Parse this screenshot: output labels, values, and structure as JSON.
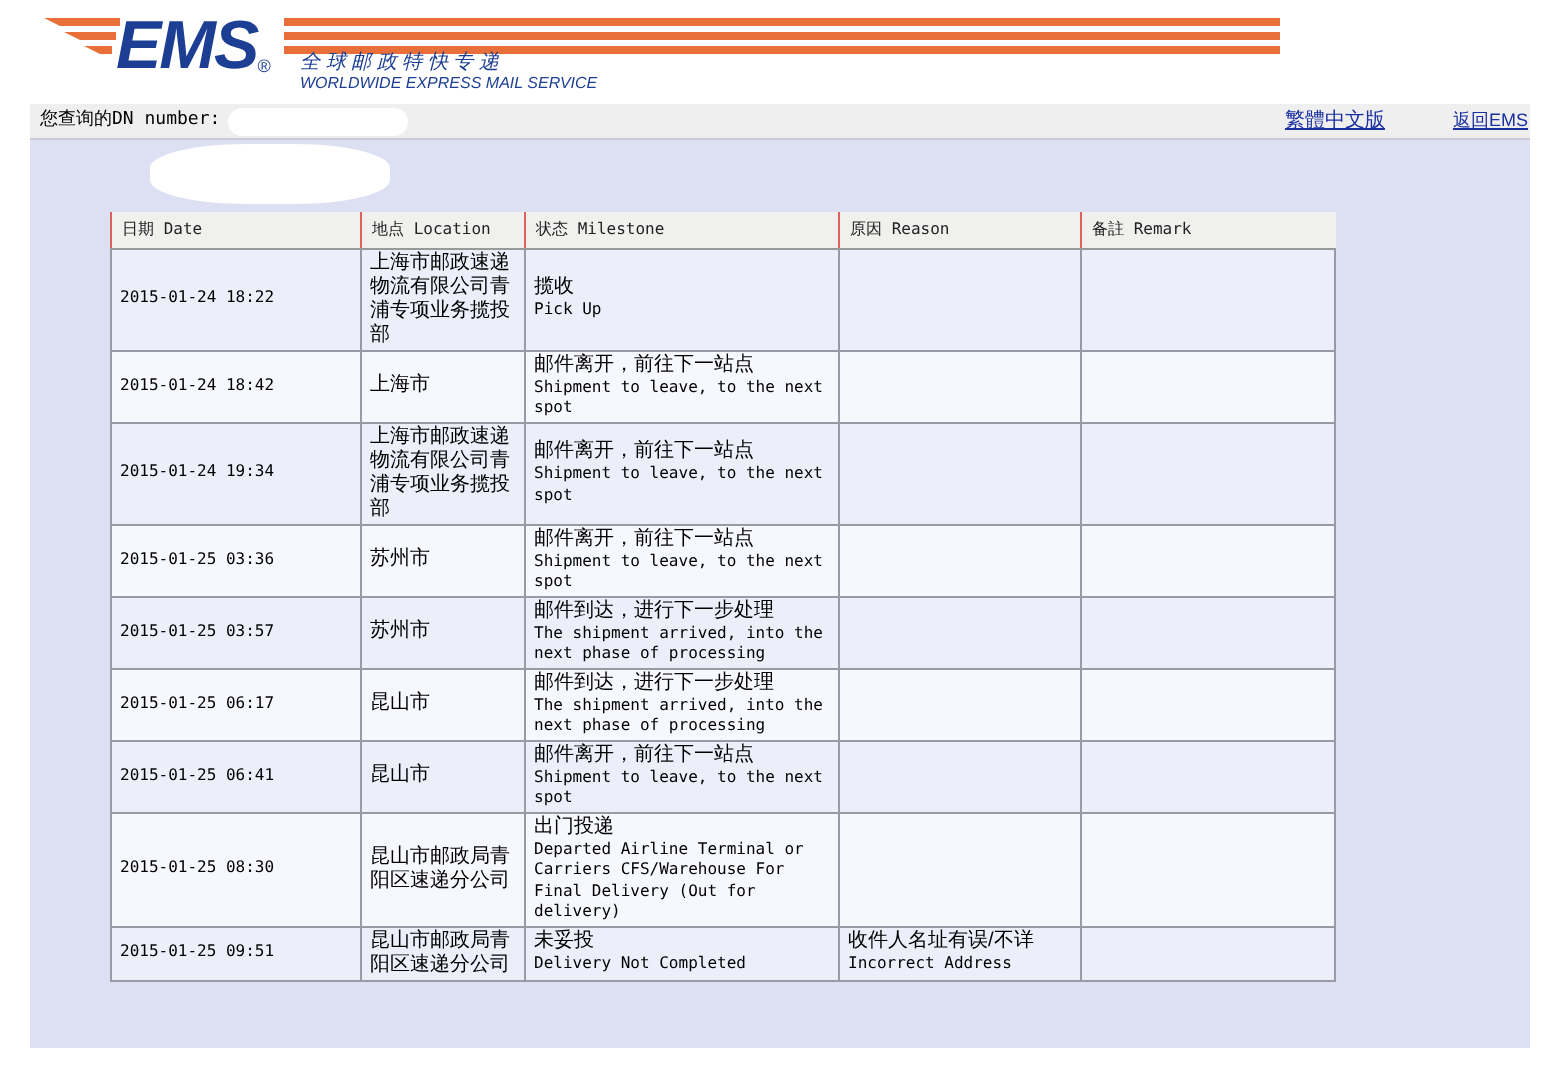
{
  "logo": {
    "mark": "EMS",
    "registered": "®",
    "tagline_cn": "全 球 邮 政 特 快 专 递",
    "tagline_en": "WORLDWIDE EXPRESS MAIL SERVICE"
  },
  "query_bar": {
    "label": "您查询的DN number:",
    "links": [
      "繁體中文版",
      "返回EMS"
    ]
  },
  "table": {
    "columns": [
      "日期 Date",
      "地点 Location",
      "状态 Milestone",
      "原因 Reason",
      "备註 Remark"
    ],
    "rows": [
      {
        "date": "2015-01-24 18:22",
        "location": "上海市邮政速递物流有限公司青浦专项业务揽投部",
        "milestone_cn": "揽收",
        "milestone_en": "Pick Up"
      },
      {
        "date": "2015-01-24 18:42",
        "location": "上海市",
        "milestone_cn": "邮件离开，前往下一站点",
        "milestone_en": "Shipment to leave, to the next spot"
      },
      {
        "date": "2015-01-24 19:34",
        "location": "上海市邮政速递物流有限公司青浦专项业务揽投部",
        "milestone_cn": "邮件离开，前往下一站点",
        "milestone_en": "Shipment to leave, to the next spot"
      },
      {
        "date": "2015-01-25 03:36",
        "location": "苏州市",
        "milestone_cn": "邮件离开，前往下一站点",
        "milestone_en": "Shipment to leave, to the next spot"
      },
      {
        "date": "2015-01-25 03:57",
        "location": "苏州市",
        "milestone_cn": "邮件到达，进行下一步处理",
        "milestone_en": "The shipment arrived, into the next phase of processing"
      },
      {
        "date": "2015-01-25 06:17",
        "location": "昆山市",
        "milestone_cn": "邮件到达，进行下一步处理",
        "milestone_en": "The shipment arrived, into the next phase of processing"
      },
      {
        "date": "2015-01-25 06:41",
        "location": "昆山市",
        "milestone_cn": "邮件离开，前往下一站点",
        "milestone_en": "Shipment to leave, to the next spot"
      },
      {
        "date": "2015-01-25 08:30",
        "location": "昆山市邮政局青阳区速递分公司",
        "milestone_cn": "出门投递",
        "milestone_en": "Departed Airline Terminal or Carriers CFS/Warehouse For Final Delivery (Out for delivery)"
      },
      {
        "date": "2015-01-25 09:51",
        "location": "昆山市邮政局青阳区速递分公司",
        "milestone_cn": "未妥投",
        "milestone_en": "Delivery Not Completed",
        "reason_cn": "收件人名址有误/不详",
        "reason_en": "Incorrect Address"
      }
    ]
  }
}
